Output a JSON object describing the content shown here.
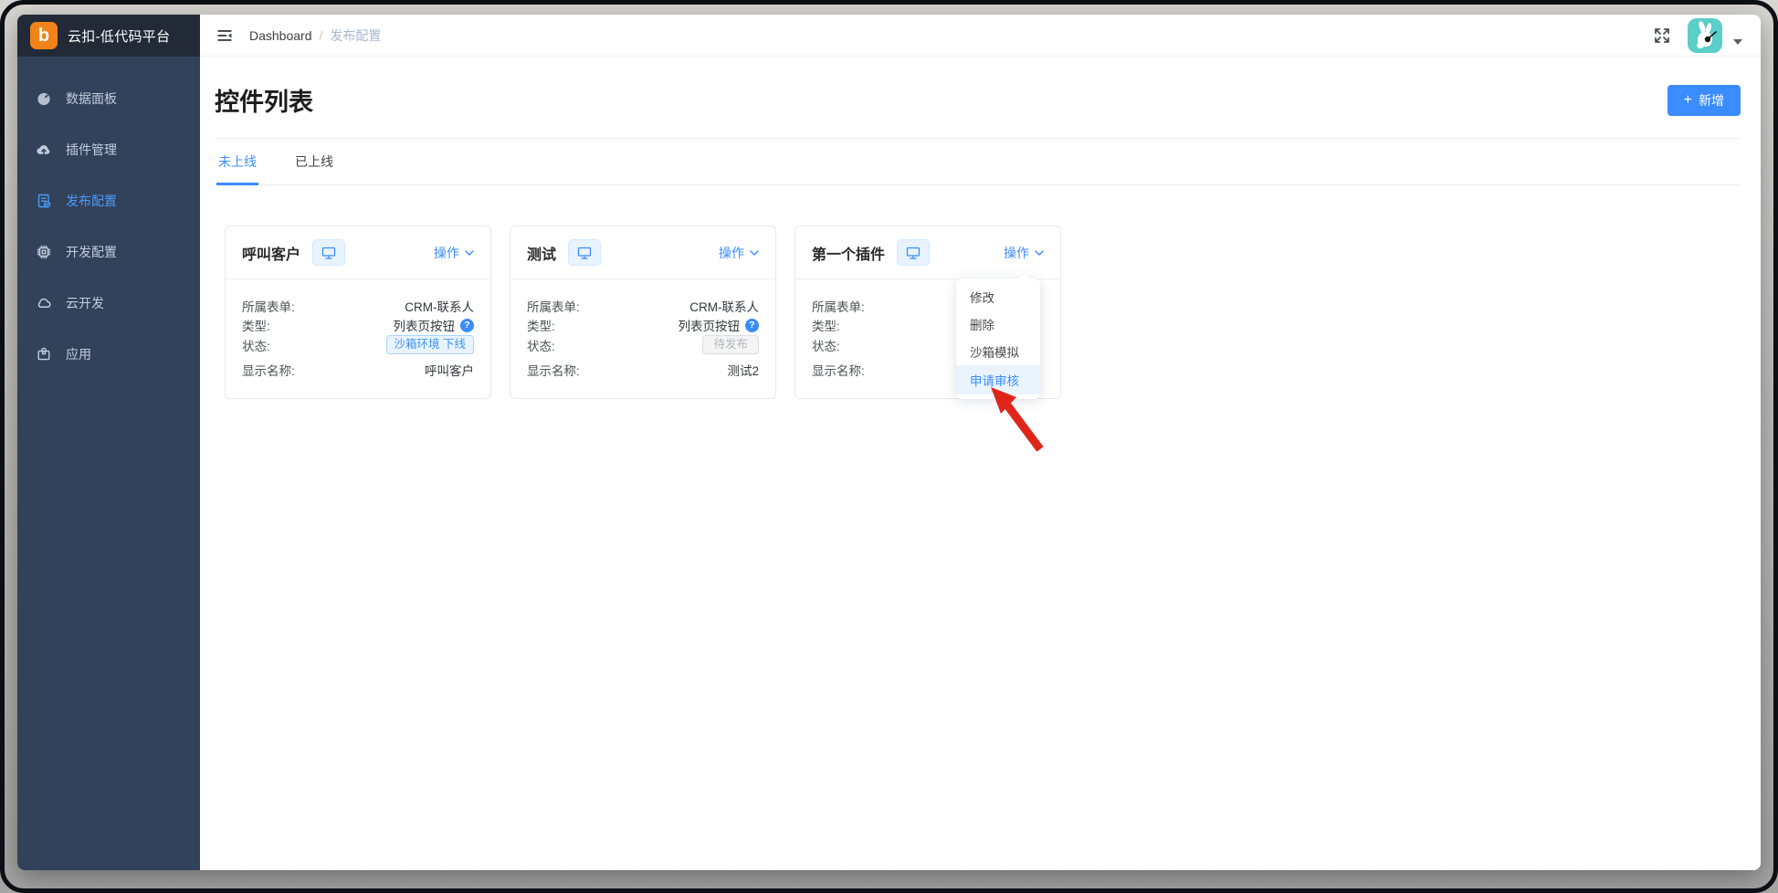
{
  "brand": {
    "name": "云扣-低代码平台",
    "letter": "b"
  },
  "sidebar": {
    "items": [
      {
        "label": "数据面板",
        "icon": "dashboard-icon",
        "active": false
      },
      {
        "label": "插件管理",
        "icon": "cloud-upload-icon",
        "active": false
      },
      {
        "label": "发布配置",
        "icon": "file-audit-icon",
        "active": true
      },
      {
        "label": "开发配置",
        "icon": "cpu-icon",
        "active": false
      },
      {
        "label": "云开发",
        "icon": "cloud-icon",
        "active": false
      },
      {
        "label": "应用",
        "icon": "app-box-icon",
        "active": false
      }
    ]
  },
  "topbar": {
    "breadcrumb": {
      "root": "Dashboard",
      "separator": "/",
      "current": "发布配置"
    }
  },
  "page": {
    "title": "控件列表",
    "add_button": {
      "plus": "+",
      "label": "新增"
    },
    "tabs": [
      {
        "label": "未上线",
        "active": true
      },
      {
        "label": "已上线",
        "active": false
      }
    ]
  },
  "cards": [
    {
      "title": "呼叫客户",
      "action": "操作",
      "fields": [
        {
          "label": "所属表单:",
          "value": "CRM-联系人"
        },
        {
          "label": "类型:",
          "value": "列表页按钮",
          "help": "?"
        },
        {
          "label": "状态:",
          "badge": "沙箱环境 下线",
          "badge_type": "blue"
        },
        {
          "label": "显示名称:",
          "value": "呼叫客户"
        }
      ]
    },
    {
      "title": "测试",
      "action": "操作",
      "fields": [
        {
          "label": "所属表单:",
          "value": "CRM-联系人"
        },
        {
          "label": "类型:",
          "value": "列表页按钮",
          "help": "?"
        },
        {
          "label": "状态:",
          "badge": "待发布",
          "badge_type": "gray"
        },
        {
          "label": "显示名称:",
          "value": "测试2"
        }
      ]
    },
    {
      "title": "第一个插件",
      "action": "操作",
      "fields": [
        {
          "label": "所属表单:",
          "value": ""
        },
        {
          "label": "类型:",
          "value": ""
        },
        {
          "label": "状态:",
          "value": ""
        },
        {
          "label": "显示名称:",
          "value": ""
        }
      ]
    }
  ],
  "dropdown": {
    "items": [
      {
        "label": "修改",
        "highlighted": false
      },
      {
        "label": "删除",
        "highlighted": false
      },
      {
        "label": "沙箱模拟",
        "highlighted": false
      },
      {
        "label": "申请审核",
        "highlighted": true
      }
    ]
  },
  "colors": {
    "accent_blue": "#3b8cfe",
    "sidebar_bg": "#33425b",
    "sidebar_header_bg": "#222a37",
    "logo_orange": "#f28318",
    "avatar_teal": "#5acec8",
    "badge_blue_text": "#3f92f7",
    "badge_blue_bg": "#e9f4ff",
    "badge_gray_text": "#b4b6b9",
    "annotation_red": "#e0251b"
  }
}
